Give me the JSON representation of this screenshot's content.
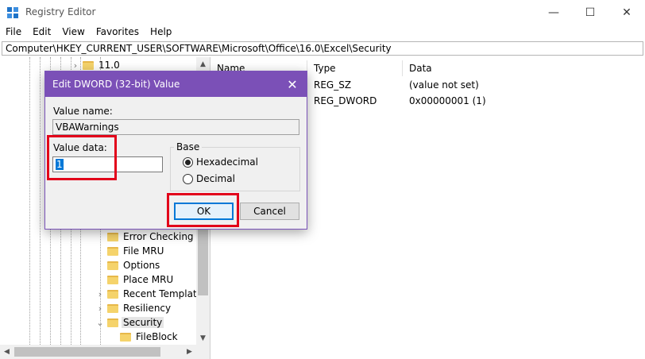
{
  "window": {
    "title": "Registry Editor",
    "minimize_glyph": "—",
    "maximize_glyph": "☐",
    "close_glyph": "✕"
  },
  "menu": [
    "File",
    "Edit",
    "View",
    "Favorites",
    "Help"
  ],
  "address": "Computer\\HKEY_CURRENT_USER\\SOFTWARE\\Microsoft\\Office\\16.0\\Excel\\Security",
  "tree": {
    "top_item": "11.0",
    "items": [
      {
        "label": "Error Checking",
        "expandable": false
      },
      {
        "label": "File MRU",
        "expandable": false
      },
      {
        "label": "Options",
        "expandable": false
      },
      {
        "label": "Place MRU",
        "expandable": false
      },
      {
        "label": "Recent Templates",
        "expandable": true
      },
      {
        "label": "Resiliency",
        "expandable": true
      },
      {
        "label": "Security",
        "expandable": true,
        "expanded": true,
        "selected": true
      }
    ],
    "child": "FileBlock"
  },
  "list": {
    "columns": [
      "Name",
      "Type",
      "Data"
    ],
    "rows": [
      {
        "type": "REG_SZ",
        "data": "(value not set)"
      },
      {
        "type": "REG_DWORD",
        "data": "0x00000001 (1)"
      }
    ]
  },
  "dialog": {
    "title": "Edit DWORD (32-bit) Value",
    "value_name_label": "Value name:",
    "value_name": "VBAWarnings",
    "value_data_label": "Value data:",
    "value_data": "1",
    "base_label": "Base",
    "radios": [
      {
        "label": "Hexadecimal",
        "checked": true
      },
      {
        "label": "Decimal",
        "checked": false
      }
    ],
    "ok_label": "OK",
    "cancel_label": "Cancel"
  },
  "colors": {
    "dialog_title": "#7b50b7",
    "highlight": "#e2001a",
    "selection": "#0078d7"
  }
}
